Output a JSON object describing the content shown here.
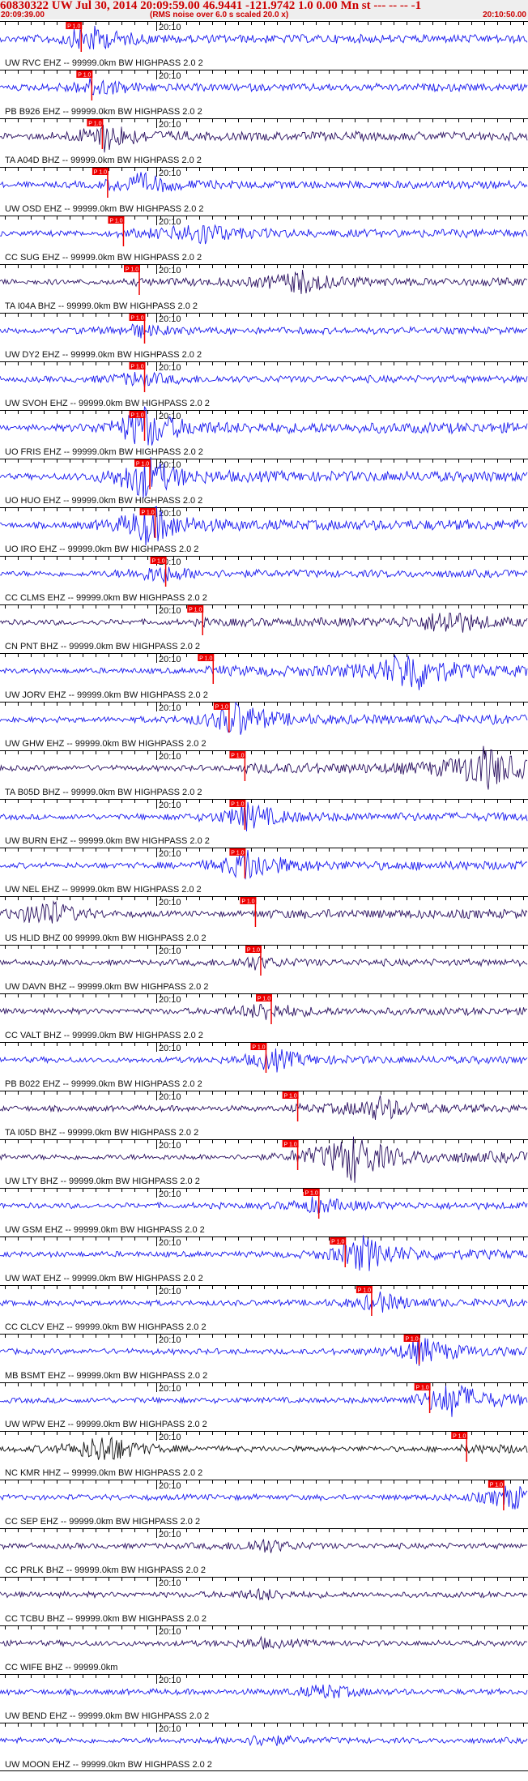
{
  "header": {
    "title": "60830322 UW Jul 30, 2014 20:09:59.00   46.9441 -121.9742  1.0 0.00 Mn st --- -- --   -1",
    "time_start": "20:09:39.00",
    "note": "(RMS noise over 6.0 s scaled 20.0 x)",
    "time_end": "20:10:50.00"
  },
  "colors": {
    "background": "#ffffff",
    "header_bg": "#eeeeee",
    "header_text": "#cc0000",
    "trace_blue": "#1a1aee",
    "trace_navy": "#2a1060",
    "trace_black": "#111111",
    "pick": "#ee0000"
  },
  "chart_data": {
    "type": "seismogram",
    "x_axis": {
      "label": "20:10",
      "range": [
        "20:09:39.00",
        "20:10:50.00"
      ]
    },
    "phase_pick_label": "P 1.0",
    "traces": [
      {
        "label": "UW RVC EHZ -- 99999.0km BW  HIGHPASS  2.0  2",
        "color": "blue",
        "pick": 0.14,
        "event": 0.17,
        "amp": 0.9
      },
      {
        "label": "PB B926 EHZ -- 99999.0km BW  HIGHPASS  2.0  2",
        "color": "blue",
        "pick": 0.16,
        "event": 0.18,
        "amp": 0.6
      },
      {
        "label": "TA A04D BHZ -- 99999.0km BW  HIGHPASS  2.0  2",
        "color": "navy",
        "pick": 0.18,
        "event": 0.2,
        "amp": 1.0
      },
      {
        "label": "UW OSD EHZ -- 99999.0km BW  HIGHPASS  2.0  2",
        "color": "blue",
        "pick": 0.19,
        "event": 0.27,
        "amp": 0.7
      },
      {
        "label": "CC SUG EHZ -- 99999.0km BW  HIGHPASS  2.0  2",
        "color": "blue",
        "pick": 0.22,
        "event": 0.38,
        "amp": 0.8
      },
      {
        "label": "TA I04A BHZ -- 99999.0km BW  HIGHPASS  2.0  2",
        "color": "navy",
        "pick": 0.25,
        "event": 0.57,
        "amp": 0.8
      },
      {
        "label": "UW DY2 EHZ -- 99999.0km BW  HIGHPASS  2.0  2",
        "color": "blue",
        "pick": 0.26,
        "event": 0.26,
        "amp": 0.4
      },
      {
        "label": "UW SVOH EHZ -- 99999.0km BW  HIGHPASS  2.0  2",
        "color": "blue",
        "pick": 0.26,
        "event": 0.26,
        "amp": 0.5
      },
      {
        "label": "UO FRIS EHZ -- 99999.0km BW  HIGHPASS  2.0  2",
        "color": "blue",
        "pick": 0.26,
        "event": 0.27,
        "amp": 1.6
      },
      {
        "label": "UO HUO EHZ -- 99999.0km BW  HIGHPASS  2.0  2",
        "color": "blue",
        "pick": 0.27,
        "event": 0.27,
        "amp": 1.6
      },
      {
        "label": "UO IRO EHZ -- 99999.0km BW  HIGHPASS  2.0  2",
        "color": "blue",
        "pick": 0.28,
        "event": 0.28,
        "amp": 1.5
      },
      {
        "label": "CC CLMS EHZ -- 99999.0km BW  HIGHPASS  2.0  2",
        "color": "blue",
        "pick": 0.3,
        "event": 0.3,
        "amp": 0.6
      },
      {
        "label": "CN PNT BHZ -- 99999.0km BW  HIGHPASS  2.0  2",
        "color": "navy",
        "pick": 0.37,
        "event": 0.85,
        "amp": 0.9
      },
      {
        "label": "UW JORV EHZ -- 99999.0km BW  HIGHPASS  2.0  2",
        "color": "blue",
        "pick": 0.39,
        "event": 0.78,
        "amp": 1.6
      },
      {
        "label": "UW GHW EHZ -- 99999.0km BW  HIGHPASS  2.0  2",
        "color": "blue",
        "pick": 0.42,
        "event": 0.45,
        "amp": 1.2
      },
      {
        "label": "TA B05D BHZ -- 99999.0km BW  HIGHPASS  2.0  2",
        "color": "navy",
        "pick": 0.45,
        "event": 0.92,
        "amp": 1.6
      },
      {
        "label": "UW BURN EHZ -- 99999.0km BW  HIGHPASS  2.0  2",
        "color": "blue",
        "pick": 0.45,
        "event": 0.47,
        "amp": 0.9
      },
      {
        "label": "UW NEL EHZ -- 99999.0km BW  HIGHPASS  2.0  2",
        "color": "blue",
        "pick": 0.45,
        "event": 0.47,
        "amp": 1.1
      },
      {
        "label": "US HLID BHZ 00 99999.0km BW  HIGHPASS  2.0  2",
        "color": "navy",
        "pick": 0.47,
        "event": 0.09,
        "amp": 1.1
      },
      {
        "label": "UW DAVN BHZ -- 99999.0km BW  HIGHPASS  2.0  2",
        "color": "navy",
        "pick": 0.48,
        "event": 0.48,
        "amp": 0.4
      },
      {
        "label": "CC VALT BHZ -- 99999.0km BW  HIGHPASS  2.0  2",
        "color": "navy",
        "pick": 0.5,
        "event": 0.5,
        "amp": 0.6
      },
      {
        "label": "PB B022 EHZ -- 99999.0km BW  HIGHPASS  2.0  2",
        "color": "blue",
        "pick": 0.49,
        "event": 0.52,
        "amp": 0.7
      },
      {
        "label": "TA I05D BHZ -- 99999.0km BW  HIGHPASS  2.0  2",
        "color": "navy",
        "pick": 0.55,
        "event": 0.72,
        "amp": 0.8
      },
      {
        "label": "UW LTY BHZ -- 99999.0km BW  HIGHPASS  2.0  2",
        "color": "navy",
        "pick": 0.55,
        "event": 0.67,
        "amp": 1.7
      },
      {
        "label": "UW GSM EHZ -- 99999.0km BW  HIGHPASS  2.0  2",
        "color": "blue",
        "pick": 0.59,
        "event": 0.6,
        "amp": 0.5
      },
      {
        "label": "UW WAT EHZ -- 99999.0km BW  HIGHPASS  2.0  2",
        "color": "blue",
        "pick": 0.64,
        "event": 0.69,
        "amp": 1.2
      },
      {
        "label": "CC CLCV EHZ -- 99999.0km BW  HIGHPASS  2.0  2",
        "color": "blue",
        "pick": 0.69,
        "event": 0.72,
        "amp": 0.6
      },
      {
        "label": "MB BSMT EHZ -- 99999.0km BW  HIGHPASS  2.0  2",
        "color": "blue",
        "pick": 0.78,
        "event": 0.8,
        "amp": 0.9
      },
      {
        "label": "UW WPW EHZ -- 99999.0km BW  HIGHPASS  2.0  2",
        "color": "blue",
        "pick": 0.8,
        "event": 0.86,
        "amp": 1.2
      },
      {
        "label": "NC KMR HHZ -- 99999.0km BW  HIGHPASS  2.0  2",
        "color": "black",
        "pick": 0.87,
        "event": 0.2,
        "amp": 1.2
      },
      {
        "label": "CC SEP EHZ -- 99999.0km BW  HIGHPASS  2.0  2",
        "color": "blue",
        "pick": 0.94,
        "event": 0.97,
        "amp": 0.8
      },
      {
        "label": "CC PRLK BHZ -- 99999.0km BW  HIGHPASS  2.0  2",
        "color": "navy",
        "pick": null,
        "event": 0.5,
        "amp": 0.5
      },
      {
        "label": "CC TCBU BHZ -- 99999.0km BW  HIGHPASS  2.0  2",
        "color": "navy",
        "pick": null,
        "event": 0.5,
        "amp": 0.35
      },
      {
        "label": "CC WIFE BHZ -- 99999.0km",
        "color": "navy",
        "pick": null,
        "event": 0.5,
        "amp": 0.3
      },
      {
        "label": "UW BEND EHZ -- 99999.0km BW  HIGHPASS  2.0  2",
        "color": "blue",
        "pick": null,
        "event": 0.62,
        "amp": 0.5
      },
      {
        "label": "UW MOON EHZ -- 99999.0km BW  HIGHPASS  2.0  2",
        "color": "blue",
        "pick": null,
        "event": 0.5,
        "amp": 0.4
      }
    ]
  }
}
